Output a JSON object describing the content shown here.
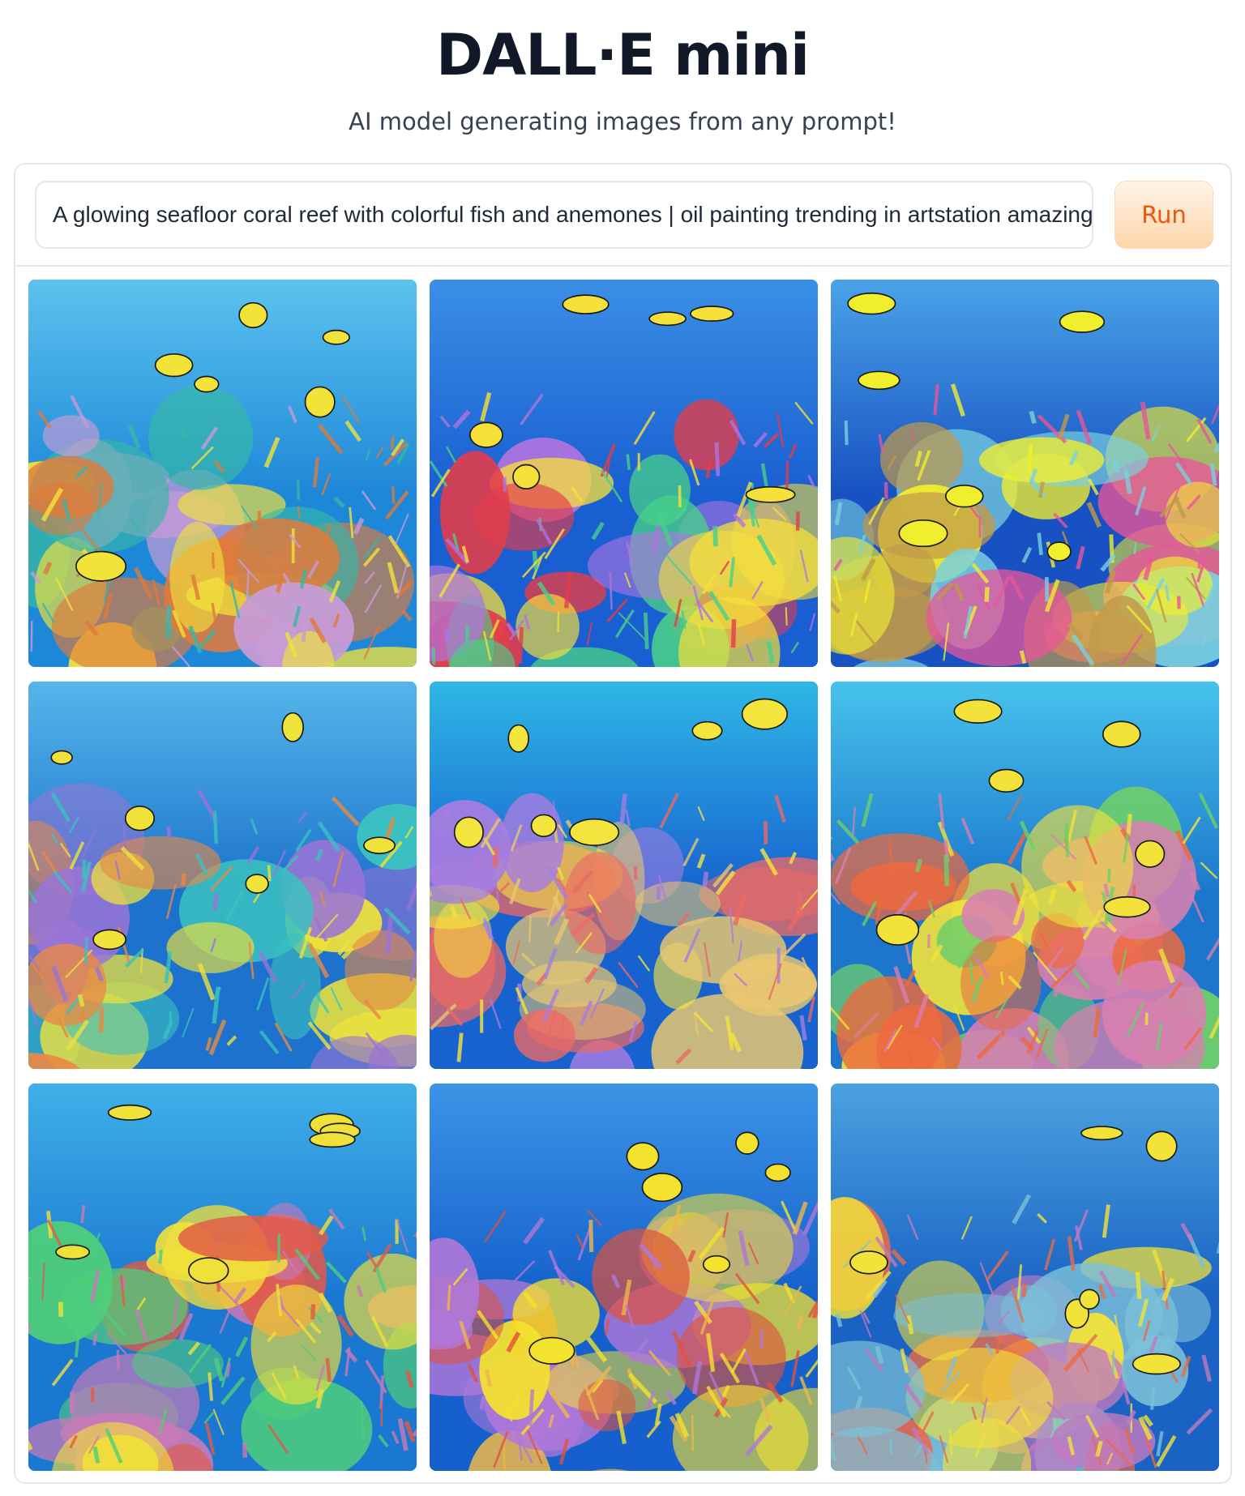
{
  "header": {
    "title": "DALL·E mini",
    "subtitle": "AI model generating images from any prompt!"
  },
  "prompt": {
    "value": "A glowing seafloor coral reef with colorful fish and anemones | oil painting trending in artstation amazing"
  },
  "run_button": {
    "label": "Run"
  },
  "colors": {
    "accent_text": "#ea580c",
    "accent_bg": "#fed7aa",
    "border": "#e5e7eb"
  },
  "gallery": {
    "images": [
      {
        "palette": [
          "#1e88d8",
          "#5cc3ee",
          "#e07a3b",
          "#f2e33a",
          "#c89bd6",
          "#36b8a8"
        ]
      },
      {
        "palette": [
          "#1a5fd1",
          "#3a8fe6",
          "#e23d4a",
          "#f6e03a",
          "#b174e0",
          "#48d08a"
        ]
      },
      {
        "palette": [
          "#1852c2",
          "#4aa3e8",
          "#e8569a",
          "#f1ee2e",
          "#c19a4a",
          "#7ad0e0"
        ]
      },
      {
        "palette": [
          "#1c72cc",
          "#54b6ea",
          "#e88a44",
          "#efe23a",
          "#9a74d6",
          "#3bc2c0"
        ]
      },
      {
        "palette": [
          "#1762cf",
          "#2fb7e6",
          "#ea6a66",
          "#f4e43e",
          "#a67ee0",
          "#e8c770"
        ]
      },
      {
        "palette": [
          "#1c77cc",
          "#47c3ec",
          "#ee6a3e",
          "#f2e23a",
          "#6fcf6a",
          "#d87fb0"
        ]
      },
      {
        "palette": [
          "#1b78d1",
          "#3fb0e8",
          "#e25a48",
          "#f0e03a",
          "#4fcf7a",
          "#c87ab8"
        ]
      },
      {
        "palette": [
          "#1560cc",
          "#3c94e6",
          "#e0533c",
          "#f3e22e",
          "#b078d8",
          "#ecb84a"
        ]
      },
      {
        "palette": [
          "#1a63c4",
          "#4ba2e0",
          "#e86b4a",
          "#f2e23a",
          "#c07ac0",
          "#7cc0d8"
        ]
      }
    ]
  }
}
